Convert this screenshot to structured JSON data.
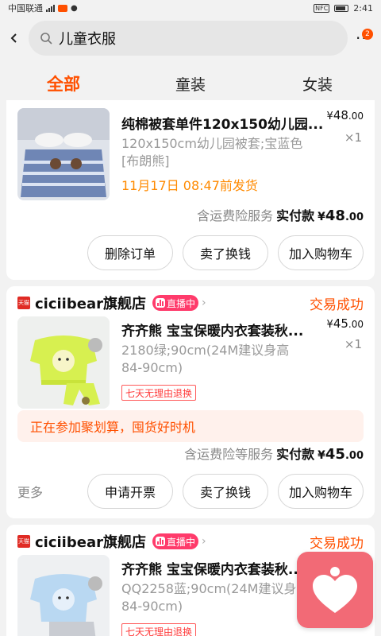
{
  "status_bar": {
    "carrier": "中国联通",
    "network": "4G",
    "time": "2:41",
    "nfc": "NFC"
  },
  "header": {
    "search_value": "儿童衣服",
    "more_badge": "2"
  },
  "tabs": [
    {
      "label": "全部",
      "active": true
    },
    {
      "label": "童装",
      "active": false
    },
    {
      "label": "女装",
      "active": false
    }
  ],
  "orders": [
    {
      "title": "纯棉被套单件120x150幼儿园...",
      "price_symbol": "¥",
      "price_int": "48",
      "price_dec": ".00",
      "qty": "×1",
      "spec_line1": "120x150cm幼儿园被套;宝蓝色",
      "spec_line2": "[布朗熊]",
      "ship_note": "11月17日 08:47前发货",
      "total_prefix": "含运费险服务",
      "total_label": "实付款",
      "total_symbol": "¥",
      "total_int": "48",
      "total_dec": ".00",
      "buttons": [
        "删除订单",
        "卖了换钱",
        "加入购物车"
      ]
    },
    {
      "shop_badge": "天猫",
      "shop_name": "ciciibear旗舰店",
      "live_label": "直播中",
      "status": "交易成功",
      "title": "齐齐熊 宝宝保暖内衣套装秋...",
      "price_symbol": "¥",
      "price_int": "45",
      "price_dec": ".00",
      "qty": "×1",
      "spec_line1": "2180绿;90cm(24M建议身高",
      "spec_line2": "84-90cm)",
      "refund_tag": "七天无理由退换",
      "promo": "正在参加聚划算，囤货好时机",
      "total_prefix": "含运费险等服务",
      "total_label": "实付款",
      "total_symbol": "¥",
      "total_int": "45",
      "total_dec": ".00",
      "more_link": "更多",
      "buttons": [
        "申请开票",
        "卖了换钱",
        "加入购物车"
      ]
    },
    {
      "shop_badge": "天猫",
      "shop_name": "ciciibear旗舰店",
      "live_label": "直播中",
      "status": "交易成功",
      "title": "齐齐熊 宝宝保暖内衣套装秋...",
      "spec_line1": "QQ2258蓝;90cm(24M建议身高",
      "spec_line2": "84-90cm)",
      "refund_tag": "七天无理由退换"
    }
  ],
  "colors": {
    "accent": "#ff5000",
    "live_badge": "#ff3b6b",
    "ship_orange": "#ff8a00",
    "fab": "#f26a76"
  },
  "icons": [
    "back-arrow-icon",
    "search-icon",
    "more-dots-icon",
    "tmall-icon",
    "live-bars-icon",
    "chevron-right-icon",
    "heart-fab-icon"
  ]
}
